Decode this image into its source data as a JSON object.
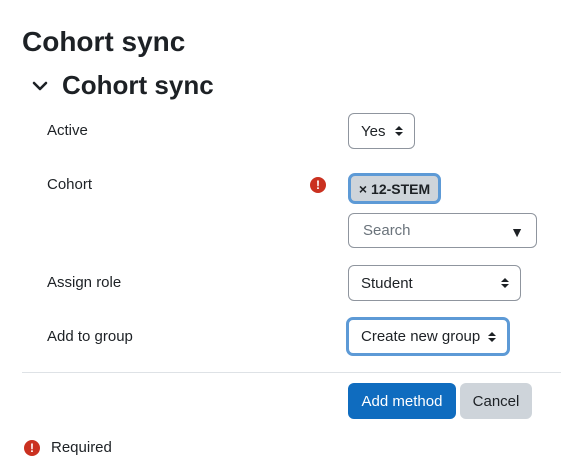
{
  "page": {
    "title": "Cohort sync"
  },
  "section": {
    "title": "Cohort sync",
    "icon": "chevron-down-icon"
  },
  "form": {
    "active": {
      "label": "Active",
      "value": "Yes"
    },
    "cohort": {
      "label": "Cohort",
      "required_icon": "exclamation-circle-icon",
      "selected": {
        "remove_symbol": "×",
        "value": "12-STEM"
      },
      "search_placeholder": "Search",
      "dropdown_symbol": "▼"
    },
    "assign_role": {
      "label": "Assign role",
      "value": "Student"
    },
    "add_to_group": {
      "label": "Add to group",
      "value": "Create new group"
    }
  },
  "buttons": {
    "add_method": "Add method",
    "cancel": "Cancel"
  },
  "footer": {
    "required_label": "Required",
    "required_icon": "exclamation-circle-icon"
  },
  "colors": {
    "primary": "#0f6cbf",
    "danger": "#ca3120",
    "focus": "#5d9ad6",
    "secondary": "#ced4da"
  }
}
